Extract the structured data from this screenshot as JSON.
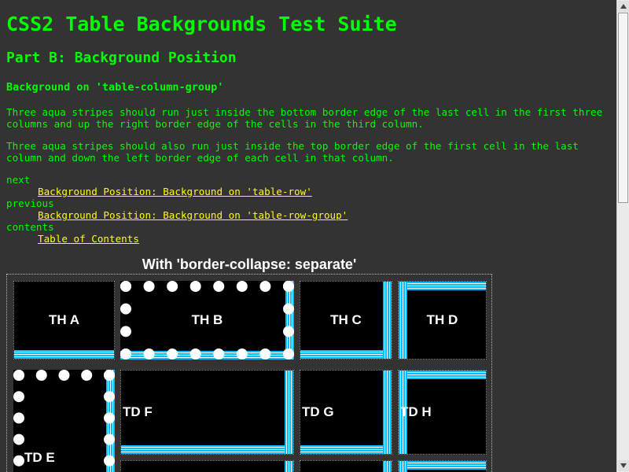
{
  "page": {
    "title": "CSS2 Table Backgrounds Test Suite",
    "part_heading": "Part B: Background Position",
    "section_heading": "Background on 'table-column-group'",
    "paragraphs": [
      "Three aqua stripes should run just inside the bottom border edge of the last cell in the first three columns and up the right border edge of the cells in the third column.",
      "Three aqua stripes should also run just inside the top border edge of the first cell in the last column and down the left border edge of each cell in that column."
    ]
  },
  "nav": {
    "next_label": "next",
    "next_link": "Background Position: Background on 'table-row'",
    "previous_label": "previous",
    "previous_link": "Background Position: Background on 'table-row-group'",
    "contents_label": "contents",
    "contents_link": "Table of Contents"
  },
  "table": {
    "caption": "With 'border-collapse: separate'",
    "header_cells": [
      "TH A",
      "TH B",
      "TH C",
      "TH D"
    ],
    "body_cells": [
      "TD E",
      "TD F",
      "TD G",
      "TD H"
    ]
  },
  "colors": {
    "background": "#333333",
    "text": "#00ff00",
    "link": "#ffff00",
    "stripe": "#00bfff",
    "cell": "#000000"
  },
  "icons": {
    "scroll_up": "triangle-up-icon",
    "scroll_down": "triangle-down-icon"
  }
}
